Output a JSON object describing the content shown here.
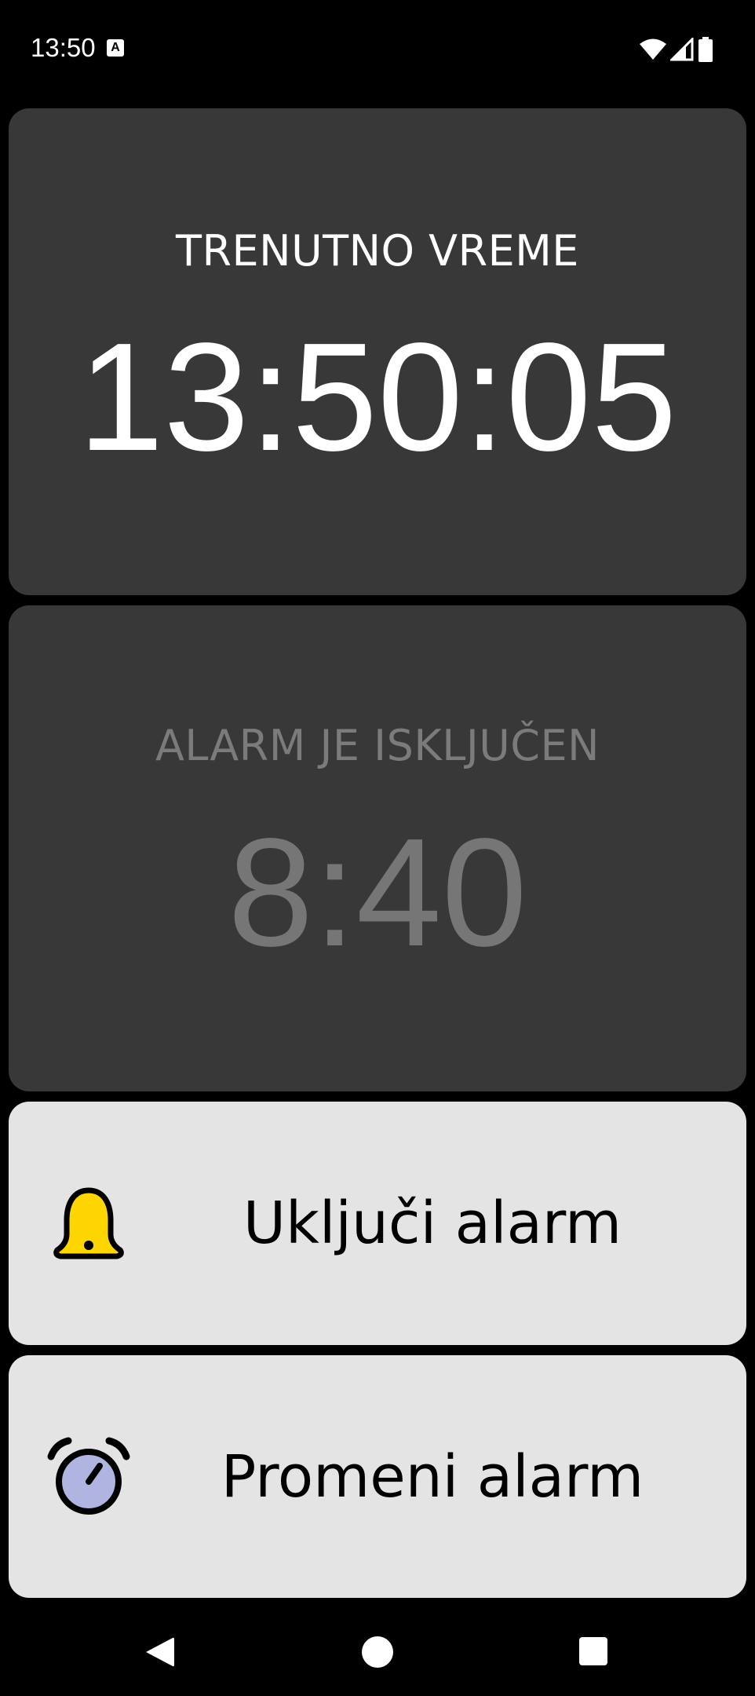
{
  "status_bar": {
    "time": "13:50",
    "notification_icon": "A",
    "icons": [
      "wifi-icon",
      "cellular-signal-icon",
      "battery-icon"
    ]
  },
  "clock": {
    "heading": "TRENUTNO VREME",
    "time": "13:50:05"
  },
  "alarm": {
    "status": "ALARM JE ISKLJUČEN",
    "time": "8:40"
  },
  "buttons": {
    "toggle_alarm": {
      "label": "Uključi alarm",
      "icon": "bell-icon"
    },
    "change_alarm": {
      "label": "Promeni alarm",
      "icon": "alarm-clock-icon"
    }
  },
  "navigation": {
    "buttons": [
      "back-icon",
      "home-icon",
      "recents-icon"
    ]
  },
  "colors": {
    "background": "#000000",
    "card_dark": "#383838",
    "card_light": "#e4e4e4",
    "bell_yellow": "#ffd500",
    "clock_face": "#b0b4e0",
    "inactive_text": "#767676"
  }
}
